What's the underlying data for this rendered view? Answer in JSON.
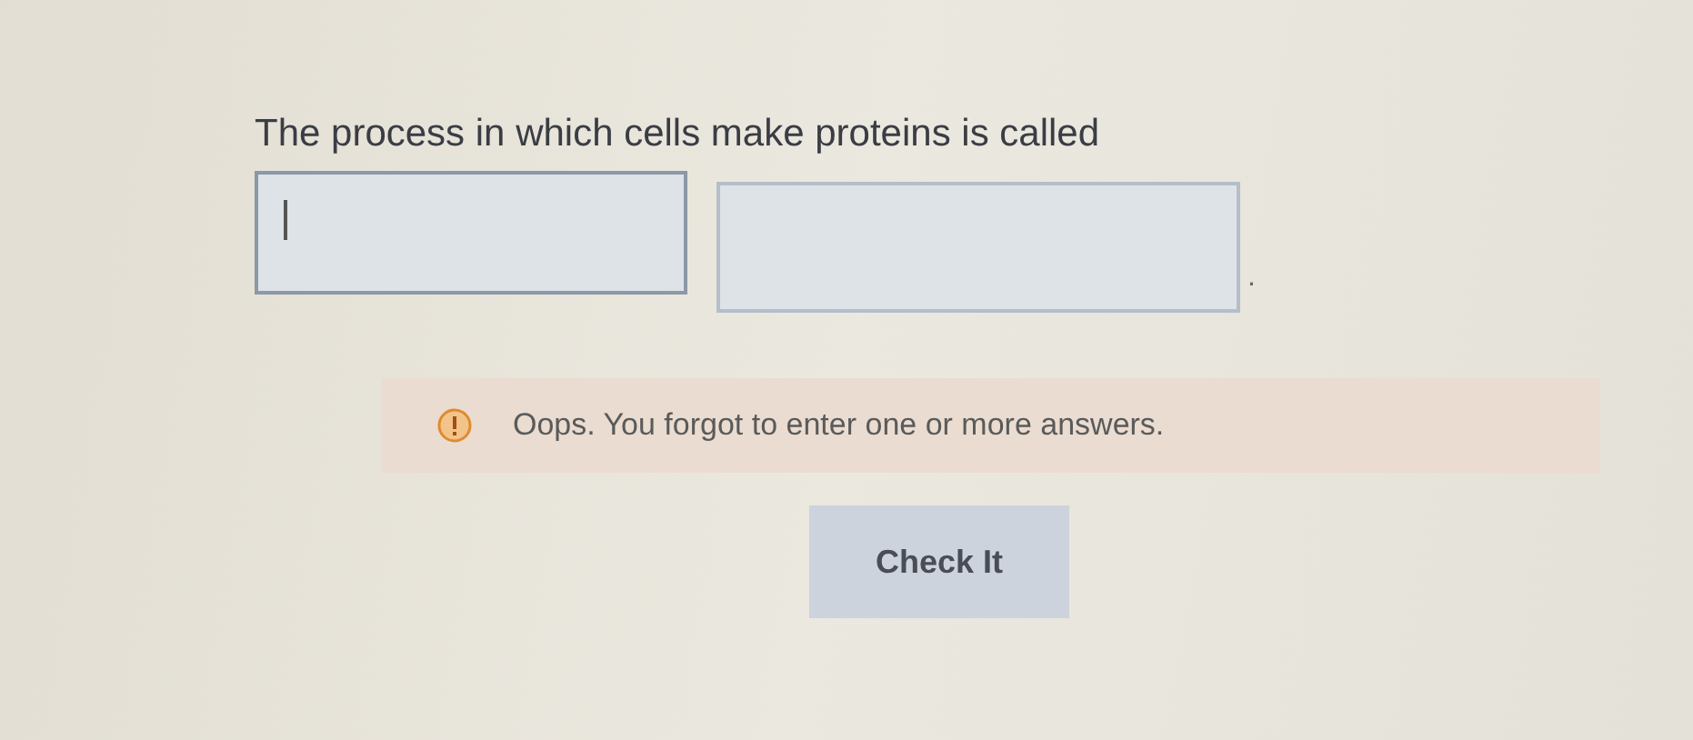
{
  "question": {
    "text": "The process in which cells make proteins is called",
    "blanks": [
      {
        "focused": true
      },
      {
        "focused": false
      }
    ],
    "end_mark": "."
  },
  "alert": {
    "message": "Oops. You forgot to enter one or more answers."
  },
  "button": {
    "label": "Check It"
  }
}
